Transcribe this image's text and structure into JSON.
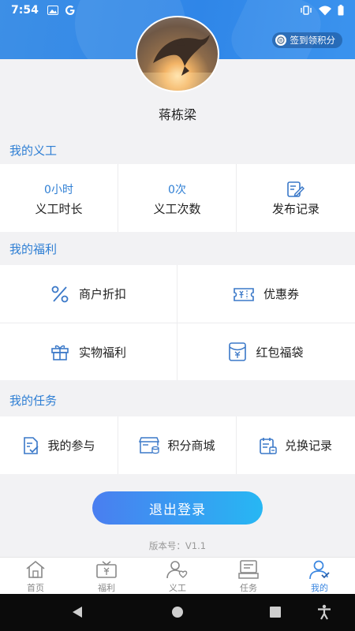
{
  "status_bar": {
    "time": "7:54"
  },
  "header": {
    "signin_label": "签到领积分"
  },
  "profile": {
    "name": "蒋栋梁"
  },
  "volunteer": {
    "title": "我的义工",
    "items": [
      {
        "value": "0小时",
        "label": "义工时长"
      },
      {
        "value": "0次",
        "label": "义工次数"
      },
      {
        "label": "发布记录",
        "icon": "edit-doc-icon"
      }
    ]
  },
  "welfare": {
    "title": "我的福利",
    "items": [
      {
        "label": "商户折扣",
        "icon": "percent-icon"
      },
      {
        "label": "优惠券",
        "icon": "coupon-icon"
      },
      {
        "label": "实物福利",
        "icon": "gift-icon"
      },
      {
        "label": "红包福袋",
        "icon": "red-envelope-icon"
      }
    ]
  },
  "tasks": {
    "title": "我的任务",
    "items": [
      {
        "label": "我的参与",
        "icon": "participation-icon"
      },
      {
        "label": "积分商城",
        "icon": "points-mall-icon"
      },
      {
        "label": "兑换记录",
        "icon": "exchange-record-icon"
      }
    ]
  },
  "logout_label": "退出登录",
  "version": "版本号：V1.1",
  "tabbar": [
    {
      "label": "首页",
      "icon": "home-icon"
    },
    {
      "label": "福利",
      "icon": "welfare-icon"
    },
    {
      "label": "义工",
      "icon": "volunteer-icon"
    },
    {
      "label": "任务",
      "icon": "task-icon"
    },
    {
      "label": "我的",
      "icon": "profile-icon",
      "active": true
    }
  ],
  "colors": {
    "accent": "#2f7fd4",
    "header": "#3a8ce8",
    "background": "#f2f2f4"
  }
}
